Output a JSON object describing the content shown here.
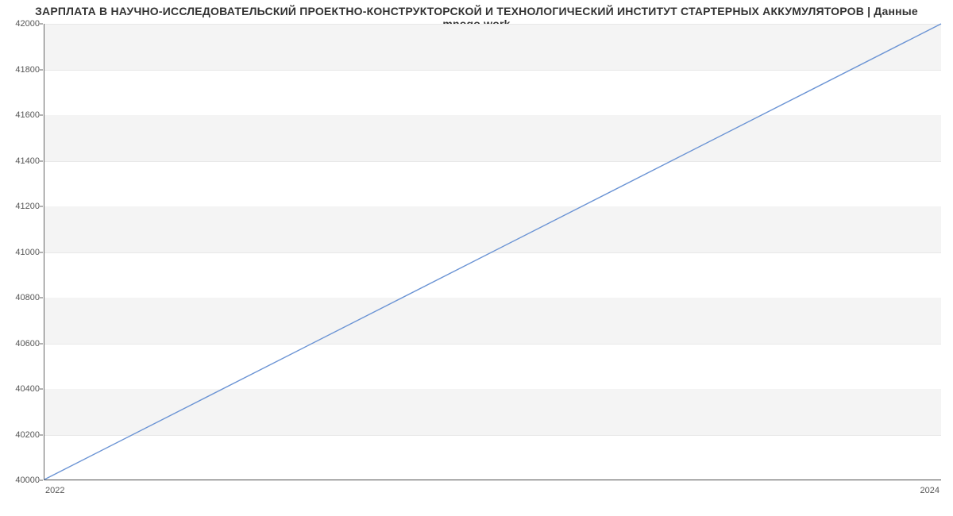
{
  "chart_data": {
    "type": "line",
    "title": "ЗАРПЛАТА В  НАУЧНО-ИССЛЕДОВАТЕЛЬСКИЙ ПРОЕКТНО-КОНСТРУКТОРСКОЙ И ТЕХНОЛОГИЧЕСКИЙ ИНСТИТУТ СТАРТЕРНЫХ АККУМУЛЯТОРОВ | Данные mnogo.work",
    "xlabel": "",
    "ylabel": "",
    "x": [
      2022,
      2024
    ],
    "values": [
      40000,
      42000
    ],
    "xlim": [
      2022,
      2024
    ],
    "ylim": [
      40000,
      42000
    ],
    "x_ticks": [
      2022,
      2024
    ],
    "y_ticks": [
      40000,
      40200,
      40400,
      40600,
      40800,
      41000,
      41200,
      41400,
      41600,
      41800,
      42000
    ],
    "line_color": "#6a93d4",
    "band_color": "#f4f4f4"
  }
}
